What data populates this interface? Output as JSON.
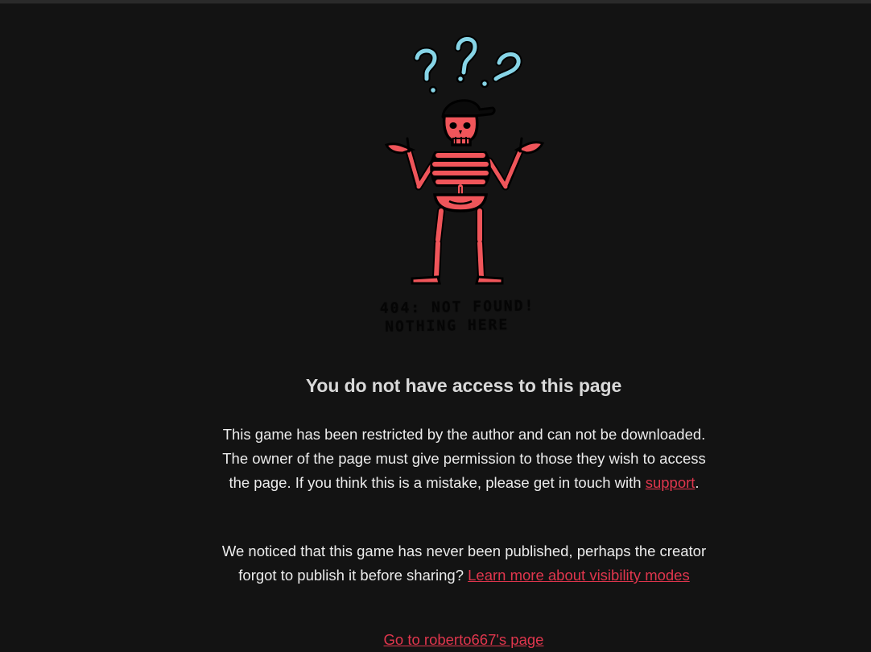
{
  "heading": "You do not have access to this page",
  "illustration": {
    "icon": "skeleton-confused-icon",
    "caption_line1": "404: NOT FOUND!",
    "caption_line2": "NOTHING HERE",
    "question_marks": [
      "?",
      "?",
      "?"
    ]
  },
  "restricted_notice": {
    "text_before_link": "This game has been restricted by the author and can not be downloaded. The owner of the page must give permission to those they wish to access the page. If you think this is a mistake, please get in touch with ",
    "support_link": "support",
    "text_after_link": "."
  },
  "unpublished_notice": {
    "text_before_link": "We noticed that this game has never been published, perhaps the creator forgot to publish it before sharing? ",
    "visibility_link": "Learn more about visibility modes"
  },
  "creator_link": "Go to roberto667's page",
  "colors": {
    "background": "#131313",
    "link": "#e0364d",
    "skeleton": "#f0555a",
    "question_marks": "#7fd3e8"
  }
}
